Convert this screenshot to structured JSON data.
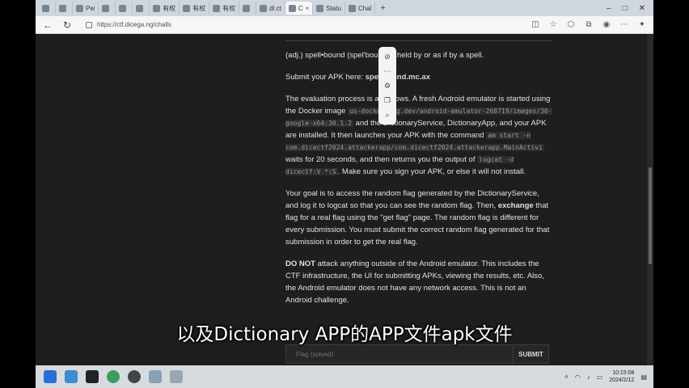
{
  "browser": {
    "tabs": [
      {
        "label": ""
      },
      {
        "label": ""
      },
      {
        "label": "Pw"
      },
      {
        "label": ""
      },
      {
        "label": ""
      },
      {
        "label": ""
      },
      {
        "label": "有权"
      },
      {
        "label": "有权"
      },
      {
        "label": "有权"
      },
      {
        "label": ""
      },
      {
        "label": "dl.ct"
      },
      {
        "label": "C",
        "active": true
      },
      {
        "label": "Statu"
      },
      {
        "label": "Chal"
      }
    ],
    "new_tab": "+",
    "url": "https://ctf.dicega.ng/challs",
    "back_icon": "arrow-left-icon",
    "refresh_icon": "refresh-icon"
  },
  "content": {
    "definition": "(adj.) spell•bound (spel'bound') : held by or as if by a spell.",
    "submit_prefix": "Submit your APK here: ",
    "submit_link": "spellbound.mc.ax",
    "eval_1": "The evaluation process is as follows. A fresh Android emulator is started using the Docker image ",
    "eval_code_1": "us-docker.pkg.dev/android-emulator-268719/images/30-google-x64:30.1.2",
    "eval_2": " and the DictionaryService, DictionaryApp, and your APK are installed. It then launches your APK with the command ",
    "eval_code_2": "am start -n com.dicectf2024.attackerapp/com.dicectf2024.attackerapp.MainActivi",
    "eval_3": " waits for 20 seconds, and then returns you the output of ",
    "eval_code_3": "logcat -d dicectf:V *:S",
    "eval_4": ". Make sure you sign your APK, or else it will not install.",
    "goal_1": "Your goal is to access the random flag generated by the DictionaryService, and log it to logcat so that you can see the random flag. Then, ",
    "goal_bold": "exchange",
    "goal_2": " that flag for a real flag using the \"get flag\" page. The random flag is different for every submission. You must submit the correct random flag generated for that submission in order to get the real flag.",
    "warn_bold": "DO NOT",
    "warn_text": " attack anything outside of the Android emulator. This includes the CTF infrastructure, the UI for submitting APKs, viewing the results, etc. Also, the Android emulator does not have any network access. This is not an Android challenge."
  },
  "flag_form": {
    "placeholder": "Flag (solved)",
    "submit_label": "SUBMIT"
  },
  "subtitle": "以及Dictionary APP的APP文件apk文件",
  "taskbar": {
    "time": "10:15:08",
    "date": "2024/2/12"
  }
}
